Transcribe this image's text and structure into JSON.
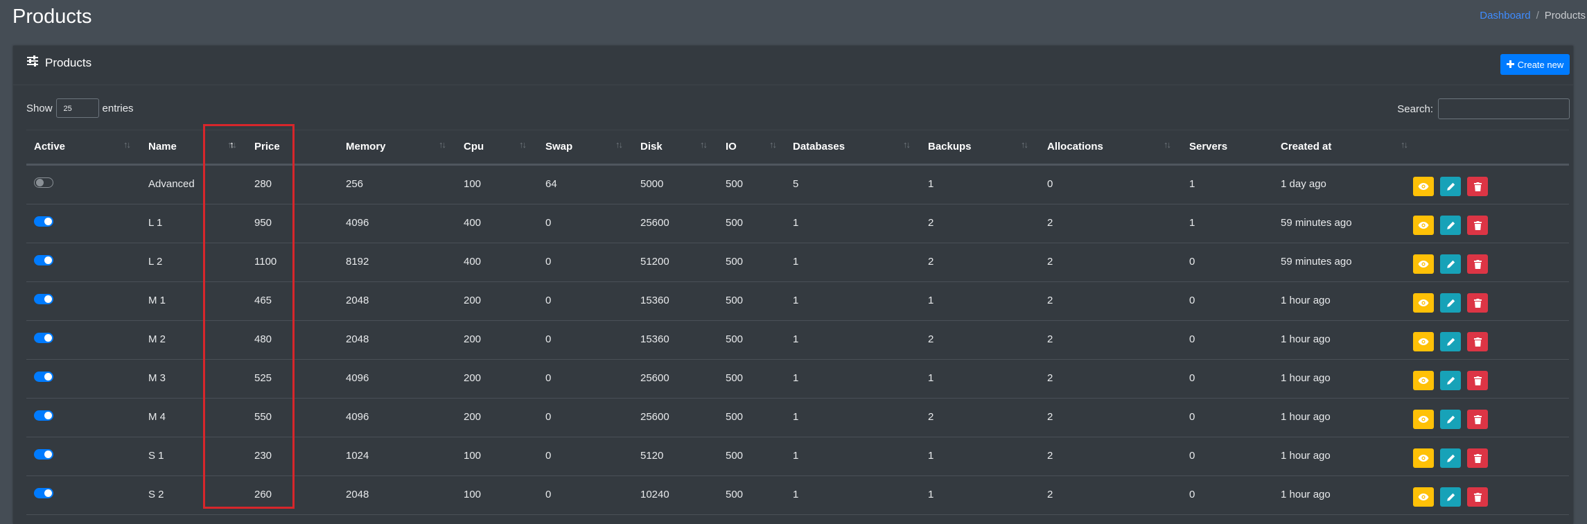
{
  "page": {
    "title": "Products"
  },
  "breadcrumb": {
    "home": "Dashboard",
    "separator": "/",
    "current": "Products"
  },
  "card": {
    "title": "Products",
    "create_label": "Create new"
  },
  "controls": {
    "show_label": "Show",
    "entries_value": "25",
    "entries_label": "entries",
    "search_label": "Search:"
  },
  "table": {
    "sorted_column": "Price",
    "columns": [
      "Active",
      "Name",
      "Price",
      "Memory",
      "Cpu",
      "Swap",
      "Disk",
      "IO",
      "Databases",
      "Backups",
      "Allocations",
      "Servers",
      "Created at"
    ],
    "rows": [
      {
        "active": false,
        "name": "Advanced",
        "price": "280",
        "memory": "256",
        "cpu": "100",
        "swap": "64",
        "disk": "5000",
        "io": "500",
        "databases": "5",
        "backups": "1",
        "allocations": "0",
        "servers": "1",
        "created": "1 day ago"
      },
      {
        "active": true,
        "name": "L 1",
        "price": "950",
        "memory": "4096",
        "cpu": "400",
        "swap": "0",
        "disk": "25600",
        "io": "500",
        "databases": "1",
        "backups": "2",
        "allocations": "2",
        "servers": "1",
        "created": "59 minutes ago"
      },
      {
        "active": true,
        "name": "L 2",
        "price": "1100",
        "memory": "8192",
        "cpu": "400",
        "swap": "0",
        "disk": "51200",
        "io": "500",
        "databases": "1",
        "backups": "2",
        "allocations": "2",
        "servers": "0",
        "created": "59 minutes ago"
      },
      {
        "active": true,
        "name": "M 1",
        "price": "465",
        "memory": "2048",
        "cpu": "200",
        "swap": "0",
        "disk": "15360",
        "io": "500",
        "databases": "1",
        "backups": "1",
        "allocations": "2",
        "servers": "0",
        "created": "1 hour ago"
      },
      {
        "active": true,
        "name": "M 2",
        "price": "480",
        "memory": "2048",
        "cpu": "200",
        "swap": "0",
        "disk": "15360",
        "io": "500",
        "databases": "1",
        "backups": "2",
        "allocations": "2",
        "servers": "0",
        "created": "1 hour ago"
      },
      {
        "active": true,
        "name": "M 3",
        "price": "525",
        "memory": "4096",
        "cpu": "200",
        "swap": "0",
        "disk": "25600",
        "io": "500",
        "databases": "1",
        "backups": "1",
        "allocations": "2",
        "servers": "0",
        "created": "1 hour ago"
      },
      {
        "active": true,
        "name": "M 4",
        "price": "550",
        "memory": "4096",
        "cpu": "200",
        "swap": "0",
        "disk": "25600",
        "io": "500",
        "databases": "1",
        "backups": "2",
        "allocations": "2",
        "servers": "0",
        "created": "1 hour ago"
      },
      {
        "active": true,
        "name": "S 1",
        "price": "230",
        "memory": "1024",
        "cpu": "100",
        "swap": "0",
        "disk": "5120",
        "io": "500",
        "databases": "1",
        "backups": "1",
        "allocations": "2",
        "servers": "0",
        "created": "1 hour ago"
      },
      {
        "active": true,
        "name": "S 2",
        "price": "260",
        "memory": "2048",
        "cpu": "100",
        "swap": "0",
        "disk": "10240",
        "io": "500",
        "databases": "1",
        "backups": "1",
        "allocations": "2",
        "servers": "0",
        "created": "1 hour ago"
      }
    ]
  },
  "colors": {
    "accent": "#007bff",
    "view": "#ffc107",
    "edit": "#17a2b8",
    "delete": "#dc3545",
    "highlight": "#d7262b"
  },
  "icons": {
    "header": "sliders-icon",
    "create": "plus-icon",
    "view": "eye-icon",
    "edit": "pencil-icon",
    "delete": "trash-icon",
    "sort": "sort-arrows-icon"
  }
}
